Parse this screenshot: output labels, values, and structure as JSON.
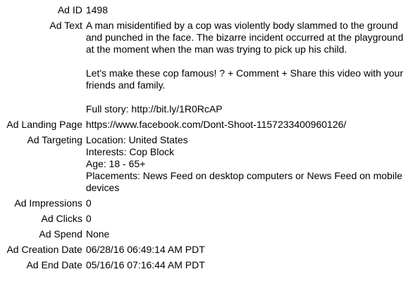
{
  "fields": [
    {
      "label": "Ad ID",
      "value": "1498"
    },
    {
      "label": "Ad Text",
      "paragraphs": [
        "A man misidentified by a cop was violently body slammed to the ground and punched in the face. The bizarre incident occurred at the playground at the moment when the man was trying to pick up his child.",
        "Let's make these cop famous! ? + Comment + Share this video with your friends and family.",
        "Full story: http://bit.ly/1R0RcAP"
      ]
    },
    {
      "label": "Ad Landing Page",
      "value": "https://www.facebook.com/Dont-Shoot-1157233400960126/"
    },
    {
      "label": "Ad Targeting",
      "lines": [
        "Location: United States",
        "Interests: Cop Block",
        "Age: 18 - 65+",
        "Placements: News Feed on desktop computers or News Feed on mobile devices"
      ]
    },
    {
      "label": "Ad Impressions",
      "value": "0"
    },
    {
      "label": "Ad Clicks",
      "value": "0"
    },
    {
      "label": "Ad Spend",
      "value": "None"
    },
    {
      "label": "Ad Creation Date",
      "value": "06/28/16 06:49:14 AM PDT"
    },
    {
      "label": "Ad End Date",
      "value": "05/16/16 07:16:44 AM PDT"
    }
  ]
}
